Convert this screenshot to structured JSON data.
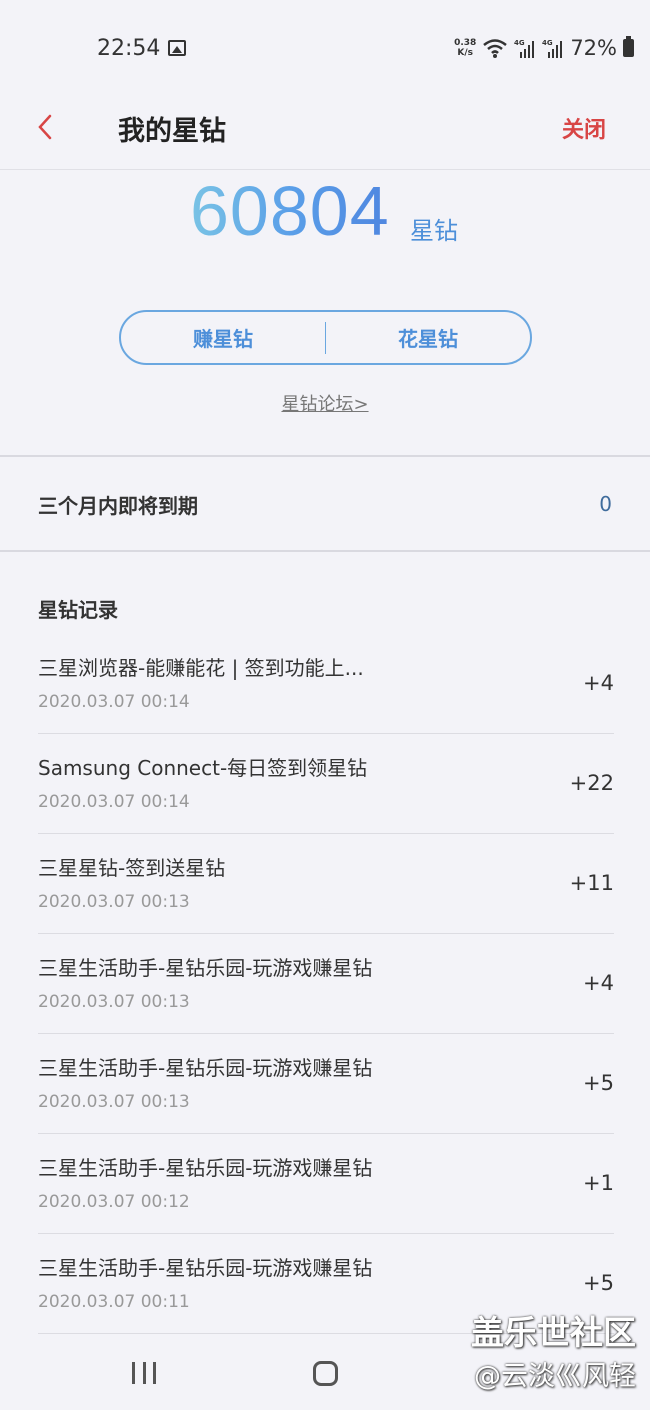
{
  "status_bar": {
    "time": "22:54",
    "net_speed_value": "0.38",
    "net_speed_unit": "K/s",
    "battery": "72%",
    "icons": [
      "gallery-icon",
      "wifi-icon",
      "signal-4g-icon",
      "signal-4g-icon",
      "battery-icon"
    ]
  },
  "header": {
    "title": "我的星钻",
    "close_label": "关闭"
  },
  "balance": {
    "amount": "60804",
    "unit": "星钻"
  },
  "actions": {
    "earn_label": "赚星钻",
    "spend_label": "花星钻"
  },
  "forum_link": "星钻论坛>",
  "expiring": {
    "label": "三个月内即将到期",
    "value": "0"
  },
  "records": {
    "title": "星钻记录",
    "items": [
      {
        "name": "三星浏览器-能赚能花 | 签到功能上...",
        "time": "2020.03.07 00:14",
        "points": "+4"
      },
      {
        "name": "Samsung Connect-每日签到领星钻",
        "time": "2020.03.07 00:14",
        "points": "+22"
      },
      {
        "name": "三星星钻-签到送星钻",
        "time": "2020.03.07 00:13",
        "points": "+11"
      },
      {
        "name": "三星生活助手-星钻乐园-玩游戏赚星钻",
        "time": "2020.03.07 00:13",
        "points": "+4"
      },
      {
        "name": "三星生活助手-星钻乐园-玩游戏赚星钻",
        "time": "2020.03.07 00:13",
        "points": "+5"
      },
      {
        "name": "三星生活助手-星钻乐园-玩游戏赚星钻",
        "time": "2020.03.07 00:12",
        "points": "+1"
      },
      {
        "name": "三星生活助手-星钻乐园-玩游戏赚星钻",
        "time": "2020.03.07 00:11",
        "points": "+5"
      }
    ]
  },
  "watermark": {
    "line1": "盖乐世社区",
    "line2": "@云淡巛风轻"
  },
  "colors": {
    "accent_blue": "#4d8fd9",
    "close_red": "#d84545",
    "background": "#f3f3f8"
  }
}
